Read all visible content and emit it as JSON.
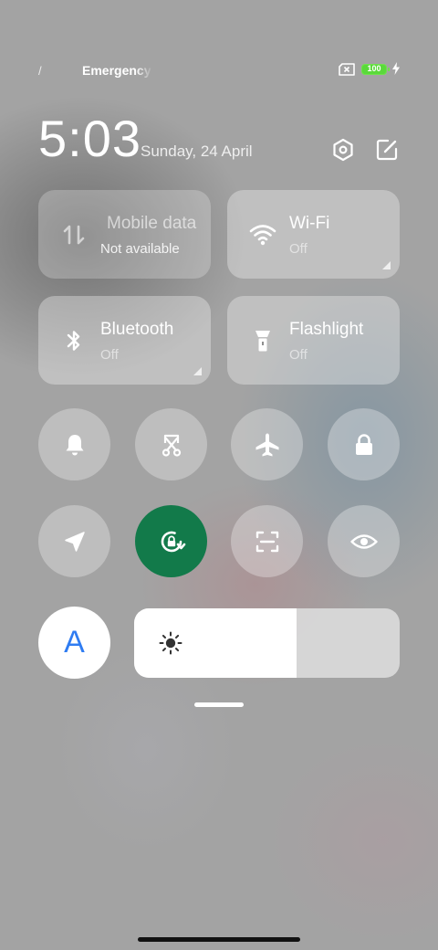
{
  "status_bar": {
    "signal_fragment": "/",
    "carrier": "Emergency",
    "battery_level": "100",
    "battery_color": "#5ad93a"
  },
  "header": {
    "time": "5:03",
    "date": "Sunday, 24 April",
    "settings_icon": "hexagon-gear-icon",
    "edit_icon": "edit-icon"
  },
  "tiles": {
    "mobile_data": {
      "title": "Mobile data",
      "subtitle": "Not available",
      "icon": "mobile-data-arrows-icon"
    },
    "wifi": {
      "title": "Wi-Fi",
      "subtitle": "Off",
      "icon": "wifi-icon"
    },
    "bluetooth": {
      "title": "Bluetooth",
      "subtitle": "Off",
      "icon": "bluetooth-icon"
    },
    "flashlight": {
      "title": "Flashlight",
      "subtitle": "Off",
      "icon": "flashlight-icon"
    }
  },
  "toggles": [
    {
      "name": "bell-icon",
      "active": false
    },
    {
      "name": "screenshot-icon",
      "active": false
    },
    {
      "name": "airplane-icon",
      "active": false
    },
    {
      "name": "lock-icon",
      "active": false
    },
    {
      "name": "location-arrow-icon",
      "active": false
    },
    {
      "name": "rotation-lock-icon",
      "active": true
    },
    {
      "name": "scan-icon",
      "active": false
    },
    {
      "name": "eye-icon",
      "active": false
    }
  ],
  "accent_color": "#127a4a",
  "brightness": {
    "auto_label": "A",
    "level": 0.61,
    "icon": "sun-icon"
  }
}
